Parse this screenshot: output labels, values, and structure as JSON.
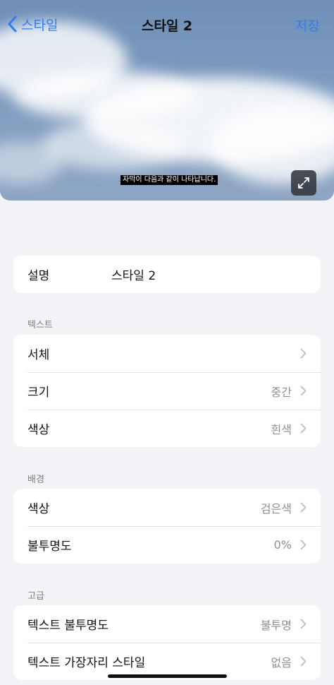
{
  "nav": {
    "back_label": "스타일",
    "title": "스타일 2",
    "save_label": "저장"
  },
  "preview": {
    "caption": "자막이 다음과 같이 나타납니다."
  },
  "description": {
    "label": "설명",
    "value": "스타일 2"
  },
  "text_section": {
    "header": "텍스트",
    "rows": [
      {
        "label": "서체",
        "value": ""
      },
      {
        "label": "크기",
        "value": "중간"
      },
      {
        "label": "색상",
        "value": "흰색"
      }
    ]
  },
  "background_section": {
    "header": "배경",
    "rows": [
      {
        "label": "색상",
        "value": "검은색"
      },
      {
        "label": "불투명도",
        "value": "0%"
      }
    ]
  },
  "advanced_section": {
    "header": "고급",
    "rows": [
      {
        "label": "텍스트 불투명도",
        "value": "불투명"
      },
      {
        "label": "텍스트 가장자리 스타일",
        "value": "없음"
      }
    ]
  },
  "colors": {
    "accent": "#2f7cf6",
    "background": "#f2f2f7",
    "secondary_text": "#8e8e93"
  }
}
